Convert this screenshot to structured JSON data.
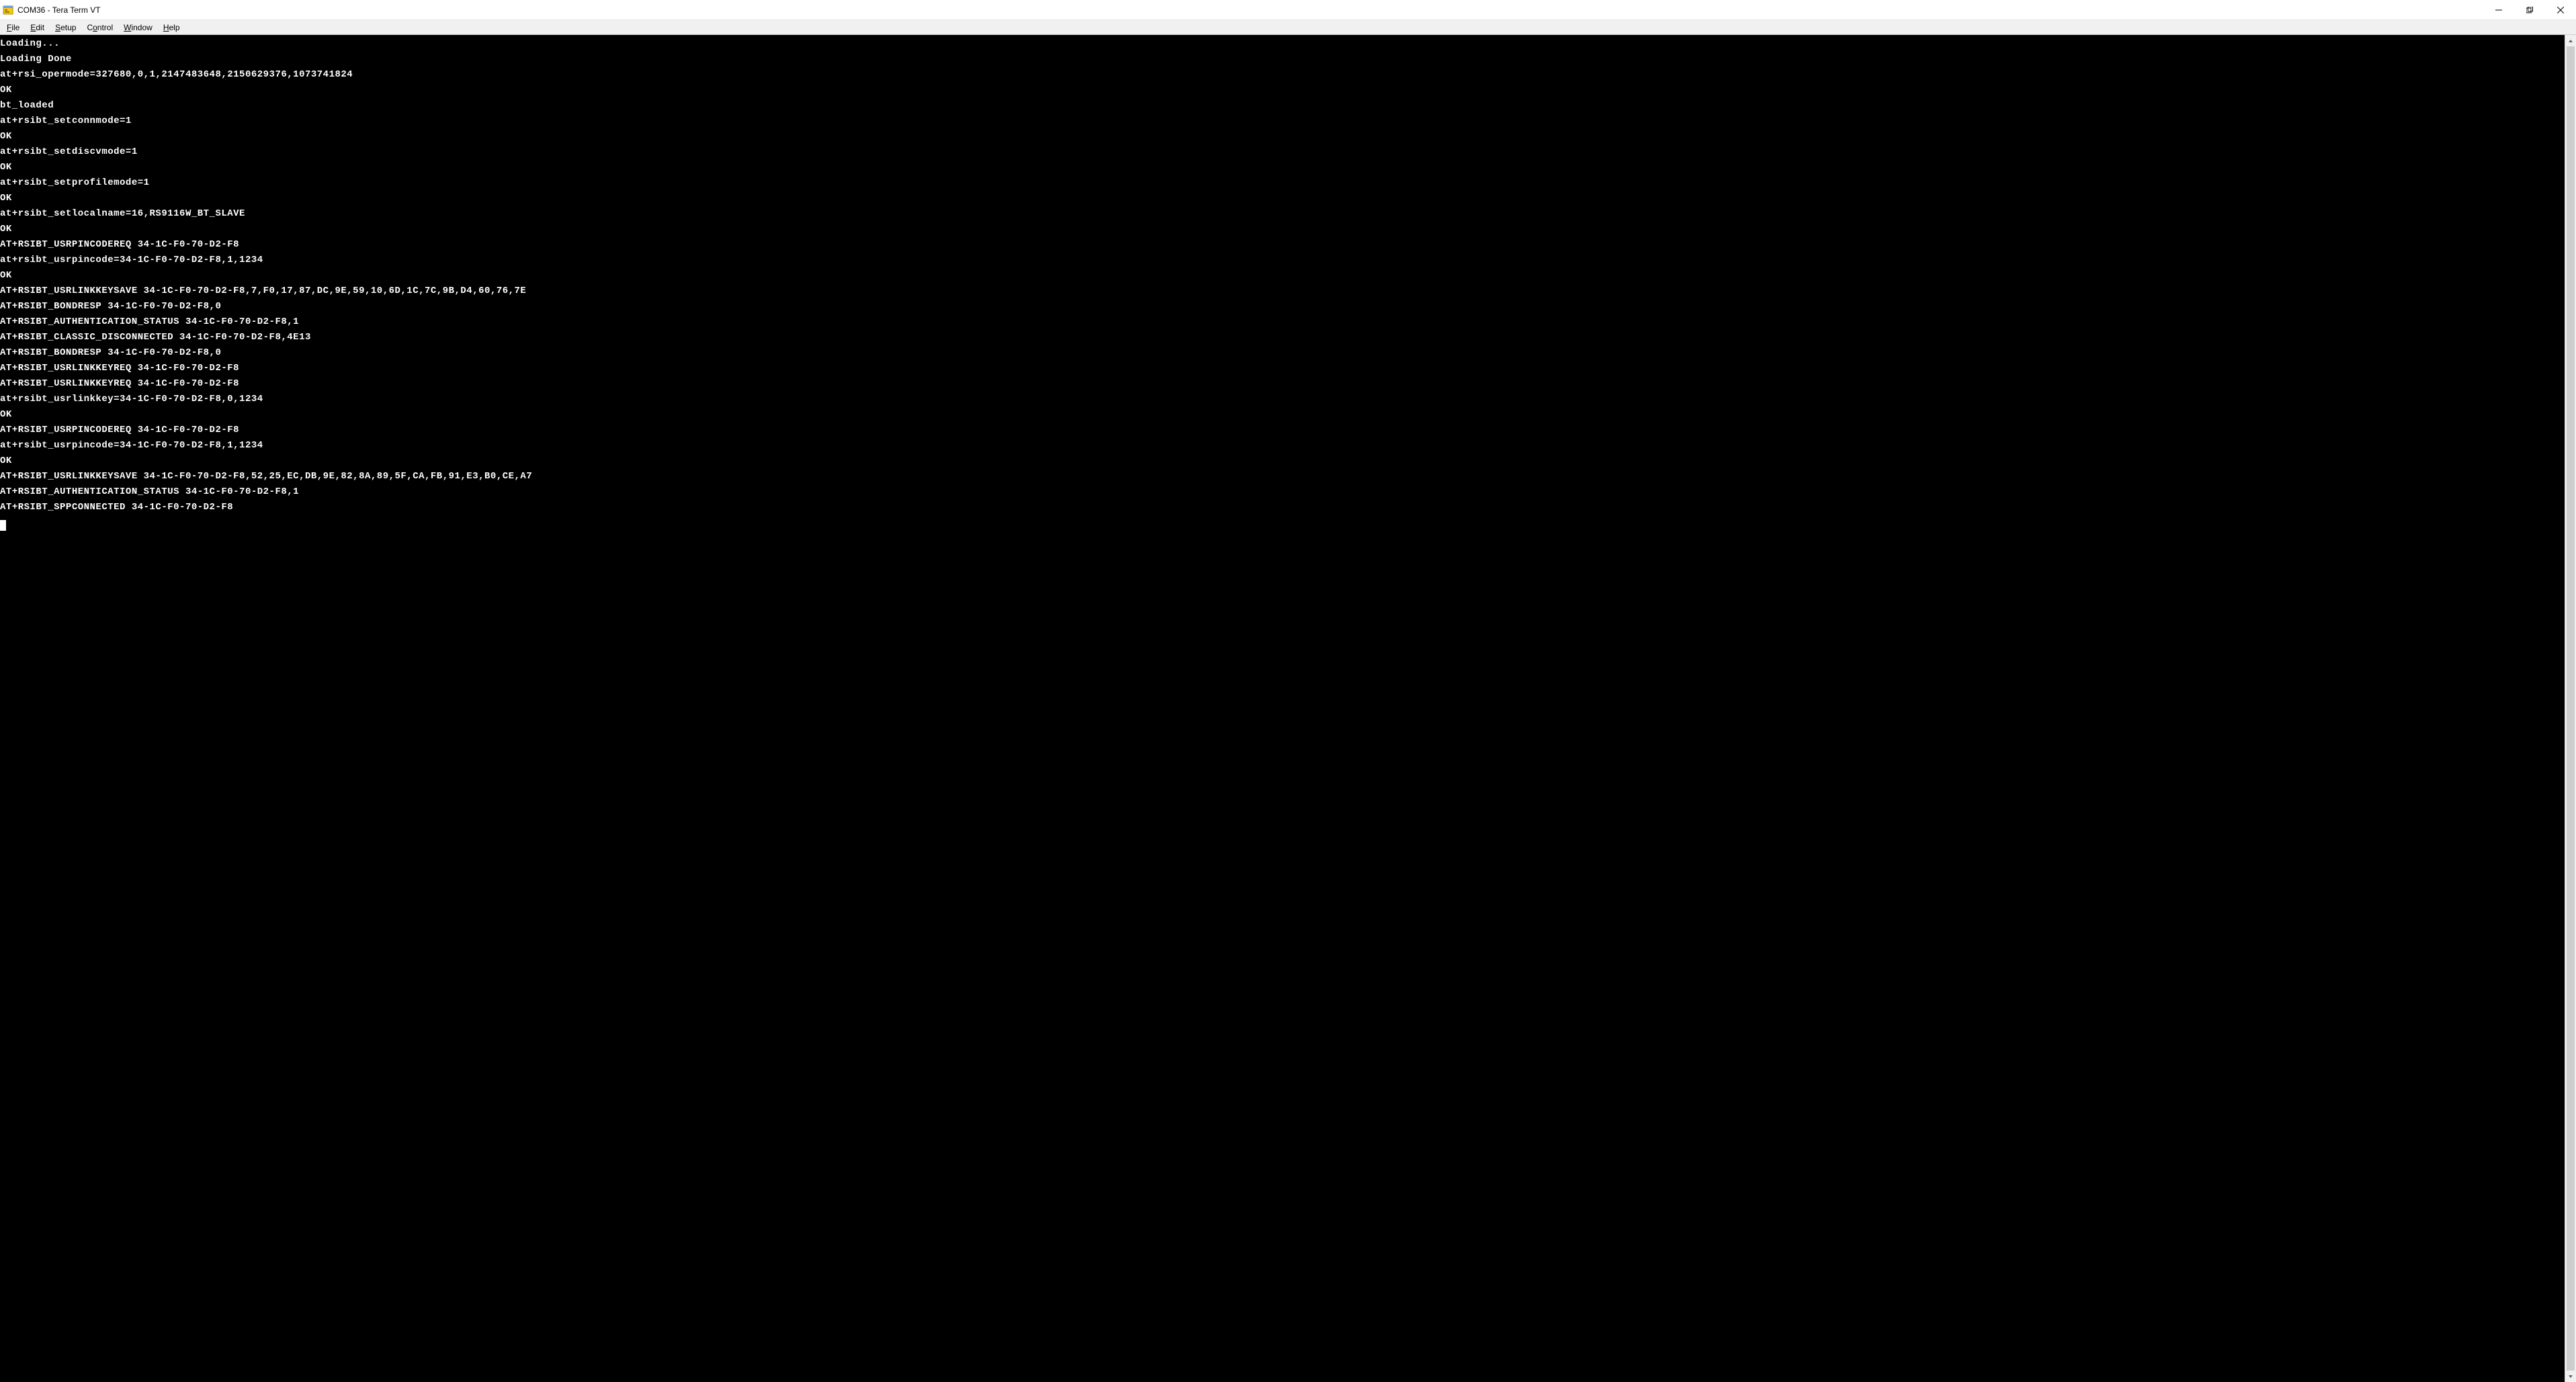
{
  "window": {
    "title": "COM36 - Tera Term VT"
  },
  "menu": {
    "items": [
      {
        "prefix": "",
        "underline": "F",
        "rest": "ile"
      },
      {
        "prefix": "",
        "underline": "E",
        "rest": "dit"
      },
      {
        "prefix": "",
        "underline": "S",
        "rest": "etup"
      },
      {
        "prefix": "C",
        "underline": "o",
        "rest": "ntrol"
      },
      {
        "prefix": "",
        "underline": "W",
        "rest": "indow"
      },
      {
        "prefix": "",
        "underline": "H",
        "rest": "elp"
      }
    ]
  },
  "terminal": {
    "lines": [
      "Loading...",
      "Loading Done",
      "at+rsi_opermode=327680,0,1,2147483648,2150629376,1073741824",
      "OK",
      "bt_loaded",
      "at+rsibt_setconnmode=1",
      "OK",
      "at+rsibt_setdiscvmode=1",
      "OK",
      "at+rsibt_setprofilemode=1",
      "OK",
      "at+rsibt_setlocalname=16,RS9116W_BT_SLAVE",
      "OK",
      "AT+RSIBT_USRPINCODEREQ 34-1C-F0-70-D2-F8",
      "at+rsibt_usrpincode=34-1C-F0-70-D2-F8,1,1234",
      "OK",
      "AT+RSIBT_USRLINKKEYSAVE 34-1C-F0-70-D2-F8,7,F0,17,87,DC,9E,59,10,6D,1C,7C,9B,D4,60,76,7E",
      "AT+RSIBT_BONDRESP 34-1C-F0-70-D2-F8,0",
      "AT+RSIBT_AUTHENTICATION_STATUS 34-1C-F0-70-D2-F8,1",
      "AT+RSIBT_CLASSIC_DISCONNECTED 34-1C-F0-70-D2-F8,4E13",
      "AT+RSIBT_BONDRESP 34-1C-F0-70-D2-F8,0",
      "AT+RSIBT_USRLINKKEYREQ 34-1C-F0-70-D2-F8",
      "AT+RSIBT_USRLINKKEYREQ 34-1C-F0-70-D2-F8",
      "at+rsibt_usrlinkkey=34-1C-F0-70-D2-F8,0,1234",
      "OK",
      "AT+RSIBT_USRPINCODEREQ 34-1C-F0-70-D2-F8",
      "at+rsibt_usrpincode=34-1C-F0-70-D2-F8,1,1234",
      "OK",
      "AT+RSIBT_USRLINKKEYSAVE 34-1C-F0-70-D2-F8,52,25,EC,DB,9E,82,8A,89,5F,CA,FB,91,E3,B0,CE,A7",
      "AT+RSIBT_AUTHENTICATION_STATUS 34-1C-F0-70-D2-F8,1",
      "AT+RSIBT_SPPCONNECTED 34-1C-F0-70-D2-F8"
    ]
  }
}
